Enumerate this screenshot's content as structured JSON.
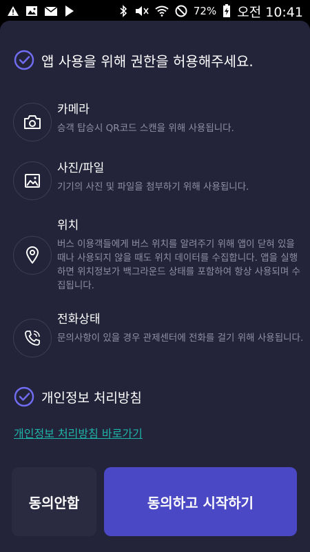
{
  "status_bar": {
    "battery": "72%",
    "time": "오전 10:41"
  },
  "header": {
    "title": "앱 사용을 위해 권한을 허용해주세요."
  },
  "permissions": [
    {
      "icon": "camera-icon",
      "title": "카메라",
      "description": "승객 탑승시 QR코드 스캔을 위해 사용됩니다."
    },
    {
      "icon": "image-icon",
      "title": "사진/파일",
      "description": "기기의 사진 및 파일을 첨부하기 위해 사용됩니다."
    },
    {
      "icon": "location-pin-icon",
      "title": "위치",
      "description": "버스 이용객들에게 버스 위치를 알려주기 위해 앱이 닫혀 있을 때나 사용되지 않을 때도 위치 데이터를 수집합니다. 앱을 실행하면 위치정보가 백그라운드 상태를 포함하여 항상 사용되며 수집됩니다."
    },
    {
      "icon": "phone-icon",
      "title": "전화상태",
      "description": "문의사항이 있을 경우 관제센터에 전화를 걸기 위해 사용됩니다."
    }
  ],
  "privacy": {
    "title": "개인정보 처리방침",
    "link": "개인정보 처리방침 바로가기"
  },
  "buttons": {
    "decline": "동의안함",
    "accept": "동의하고 시작하기"
  },
  "colors": {
    "background": "#23233a",
    "accent": "#4a48c4",
    "check": "#6f6cf0",
    "link": "#1fb4a8"
  }
}
